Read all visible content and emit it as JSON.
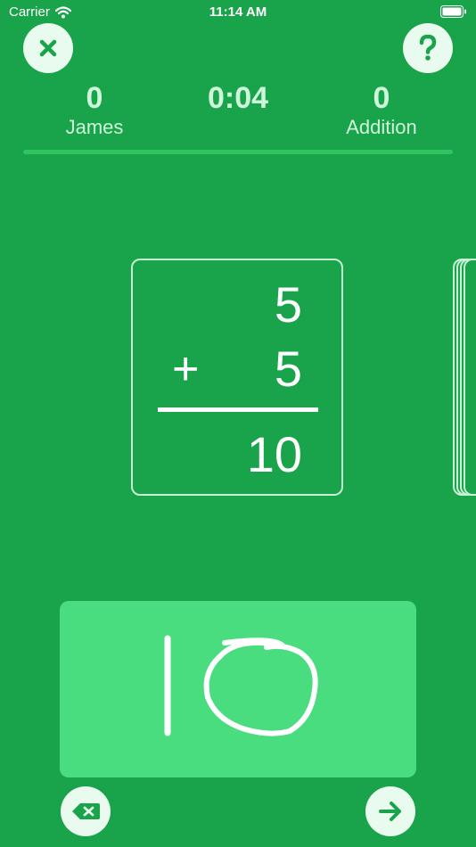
{
  "status_bar": {
    "carrier": "Carrier",
    "time": "11:14 AM"
  },
  "header": {
    "close_icon": "close-icon",
    "help_icon": "question-mark-icon"
  },
  "scoreboard": {
    "player_score": "0",
    "player_name": "James",
    "timer": "0:04",
    "mode_score": "0",
    "mode_name": "Addition"
  },
  "problem": {
    "top_number": "5",
    "operator": "+",
    "bottom_number": "5",
    "answer": "10"
  },
  "controls": {
    "clear_icon": "backspace-icon",
    "next_icon": "arrow-right-icon"
  },
  "colors": {
    "background": "#19a34a",
    "button_fill": "#e9fbef",
    "icon": "#19a34a",
    "draw_pad": "#49dd80",
    "card_border": "#c8f2d5"
  }
}
